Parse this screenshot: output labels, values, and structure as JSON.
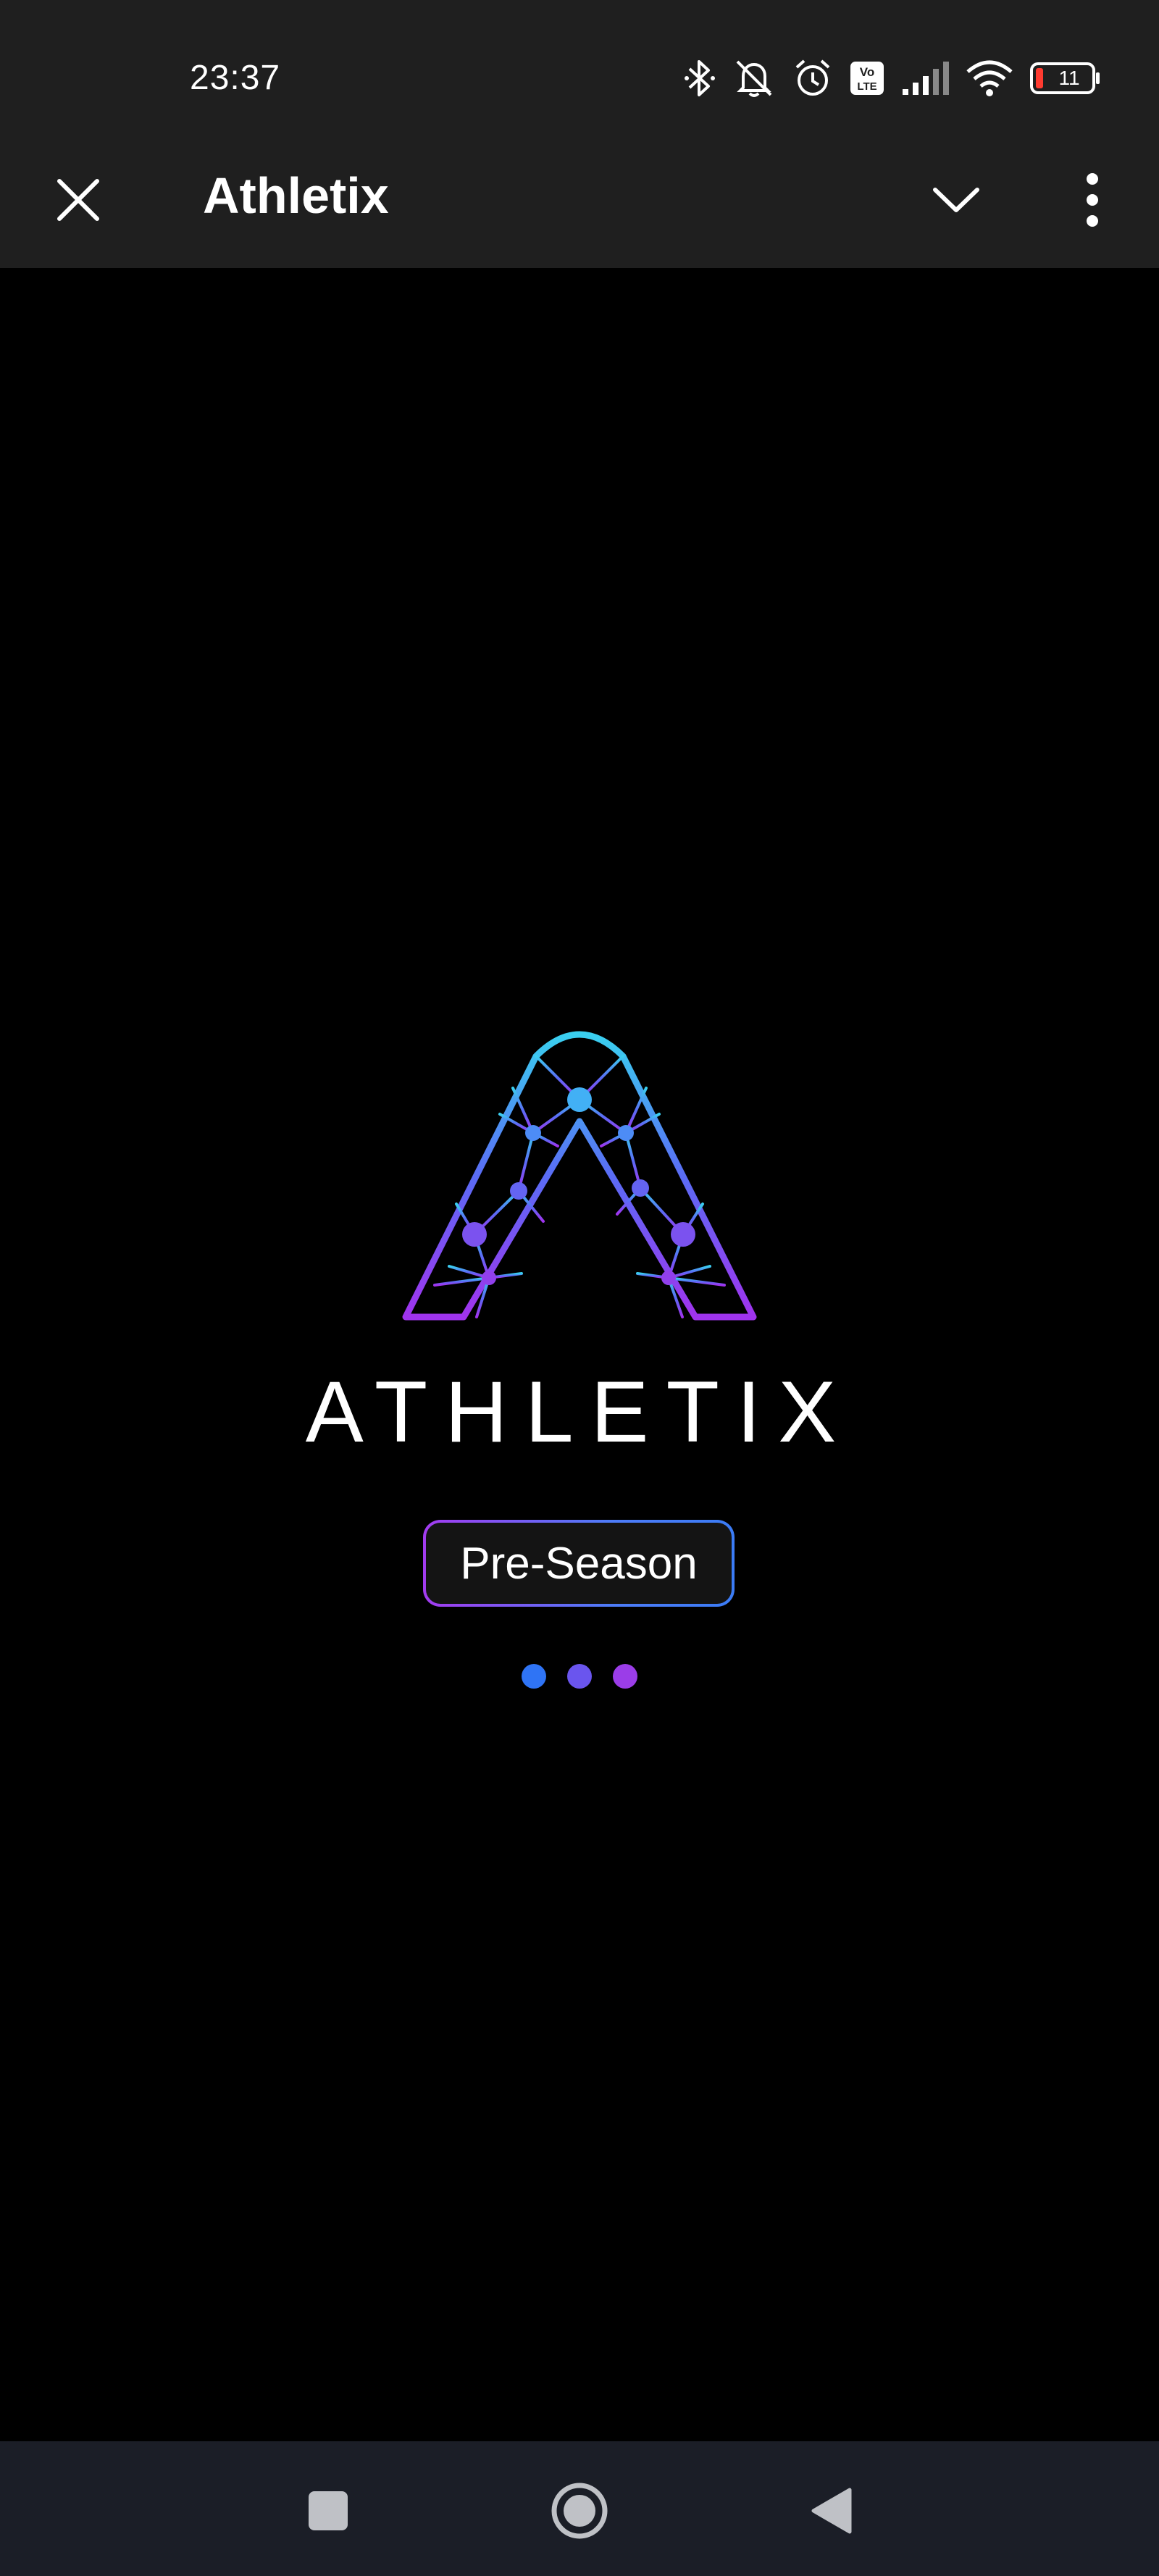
{
  "status_bar": {
    "time": "23:37",
    "battery_level": "11",
    "icons": [
      "bluetooth-icon",
      "silent-icon",
      "alarm-icon",
      "volte-icon",
      "signal-icon",
      "wifi-icon",
      "battery-icon"
    ]
  },
  "app_bar": {
    "title": "Athletix",
    "icons": [
      "close-icon",
      "chevron-down-icon",
      "more-vert-icon"
    ]
  },
  "splash": {
    "brand_wordmark": "ATHLETIX",
    "season_badge": "Pre-Season",
    "loading_dots": 3,
    "colors": {
      "gradient_top": "#3ad0f0",
      "gradient_mid": "#4e7cf8",
      "gradient_bottom": "#a33bf0",
      "dot_1": "#2f74f5",
      "dot_2": "#6a55ee",
      "dot_3": "#9b3de8"
    }
  },
  "nav_bar": {
    "icons": [
      "recents-square-icon",
      "home-circle-icon",
      "back-triangle-icon"
    ]
  }
}
